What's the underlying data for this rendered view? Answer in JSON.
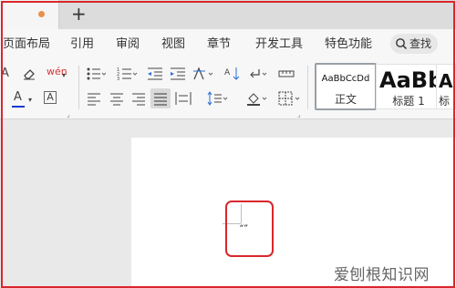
{
  "tabbar": {
    "new_tab_label": "+"
  },
  "menu": {
    "items": [
      "页面布局",
      "引用",
      "审阅",
      "视图",
      "章节",
      "开发工具",
      "特色功能"
    ],
    "search_label": "查找"
  },
  "ribbon": {
    "font": {
      "shrink_font": "A",
      "clear_format_icon": "eraser-icon",
      "phonetic": "wén",
      "font_color": "A",
      "char_border": "A"
    },
    "styles": [
      {
        "preview": "AaBbCcDd",
        "name": "正文"
      },
      {
        "preview": "AaBb",
        "name": "标题 1"
      },
      {
        "preview": "Aa",
        "name": "标"
      }
    ]
  },
  "document": {
    "cursor_text": "“”"
  },
  "watermark": "爱刨根知识网",
  "colors": {
    "accent_red": "#d9262c",
    "font_color_underline": "#1b3bd1",
    "tab_dot": "#e8914a"
  }
}
